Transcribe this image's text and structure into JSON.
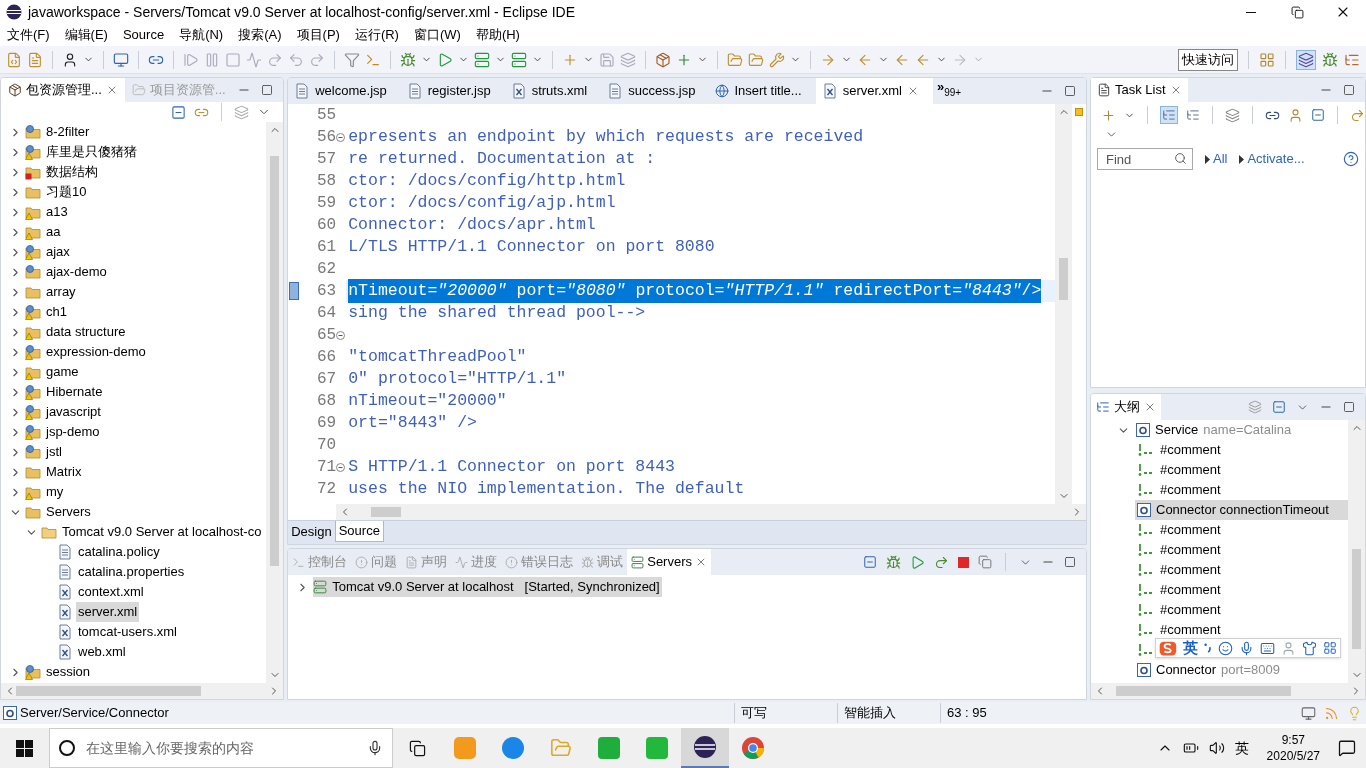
{
  "window": {
    "title": "javaworkspace - Servers/Tomcat v9.0 Server at localhost-config/server.xml - Eclipse IDE"
  },
  "menu": [
    "文件(F)",
    "编辑(E)",
    "Source",
    "导航(N)",
    "搜索(A)",
    "项目(P)",
    "运行(R)",
    "窗口(W)",
    "帮助(H)"
  ],
  "quick_access": "快速访问",
  "package_explorer": {
    "tabs": [
      {
        "label": "包资源管理...",
        "selected": true
      },
      {
        "label": "项目资源管...",
        "selected": false
      }
    ],
    "tree": [
      {
        "label": "8-2filter",
        "kind": "project",
        "warning": false,
        "error": false,
        "expanded": false,
        "selected": false
      },
      {
        "label": "库里是只傻猪猪",
        "kind": "project",
        "warning": true,
        "error": false,
        "expanded": false,
        "selected": false
      },
      {
        "label": "数据结构",
        "kind": "folder",
        "warning": false,
        "error": true,
        "expanded": false,
        "selected": false
      },
      {
        "label": "习题10",
        "kind": "folder",
        "warning": false,
        "error": false,
        "expanded": false,
        "selected": false
      },
      {
        "label": "a13",
        "kind": "folder",
        "warning": true,
        "error": false,
        "expanded": false,
        "selected": false
      },
      {
        "label": "aa",
        "kind": "folder",
        "warning": true,
        "error": false,
        "expanded": false,
        "selected": false
      },
      {
        "label": "ajax",
        "kind": "project",
        "warning": true,
        "error": false,
        "expanded": false,
        "selected": false
      },
      {
        "label": "ajax-demo",
        "kind": "project",
        "warning": false,
        "error": false,
        "expanded": false,
        "selected": false
      },
      {
        "label": "array",
        "kind": "folder",
        "warning": false,
        "error": false,
        "expanded": false,
        "selected": false
      },
      {
        "label": "ch1",
        "kind": "project",
        "warning": true,
        "error": false,
        "expanded": false,
        "selected": false
      },
      {
        "label": "data structure",
        "kind": "folder",
        "warning": true,
        "error": false,
        "expanded": false,
        "selected": false
      },
      {
        "label": "expression-demo",
        "kind": "project",
        "warning": true,
        "error": false,
        "expanded": false,
        "selected": false
      },
      {
        "label": "game",
        "kind": "folder",
        "warning": true,
        "error": false,
        "expanded": false,
        "selected": false
      },
      {
        "label": "Hibernate",
        "kind": "project",
        "warning": true,
        "error": false,
        "expanded": false,
        "selected": false
      },
      {
        "label": "javascript",
        "kind": "project",
        "warning": true,
        "error": false,
        "expanded": false,
        "selected": false
      },
      {
        "label": "jsp-demo",
        "kind": "project",
        "warning": true,
        "error": false,
        "expanded": false,
        "selected": false
      },
      {
        "label": "jstl",
        "kind": "project",
        "warning": false,
        "error": false,
        "expanded": false,
        "selected": false
      },
      {
        "label": "Matrix",
        "kind": "folder",
        "warning": false,
        "error": false,
        "expanded": false,
        "selected": false
      },
      {
        "label": "my",
        "kind": "folder",
        "warning": true,
        "error": false,
        "expanded": false,
        "selected": false
      },
      {
        "label": "Servers",
        "kind": "folder",
        "warning": false,
        "error": false,
        "expanded": true,
        "selected": false,
        "children": [
          {
            "label": "Tomcat v9.0 Server at localhost-co",
            "kind": "open-folder",
            "expanded": true,
            "selected": false,
            "children": [
              {
                "label": "catalina.policy",
                "kind": "file",
                "selected": false
              },
              {
                "label": "catalina.properties",
                "kind": "file",
                "selected": false
              },
              {
                "label": "context.xml",
                "kind": "xml",
                "selected": false
              },
              {
                "label": "server.xml",
                "kind": "xml",
                "selected": true
              },
              {
                "label": "tomcat-users.xml",
                "kind": "xml",
                "selected": false
              },
              {
                "label": "web.xml",
                "kind": "xml",
                "selected": false
              }
            ]
          }
        ]
      },
      {
        "label": "session",
        "kind": "project",
        "warning": true,
        "error": false,
        "expanded": false,
        "selected": false
      }
    ]
  },
  "editor": {
    "tabs": [
      {
        "label": "welcome.jsp",
        "kind": "page",
        "selected": false
      },
      {
        "label": "register.jsp",
        "kind": "page",
        "selected": false
      },
      {
        "label": "struts.xml",
        "kind": "xml",
        "selected": false
      },
      {
        "label": "success.jsp",
        "kind": "page",
        "selected": false
      },
      {
        "label": "Insert title...",
        "kind": "web",
        "selected": false
      },
      {
        "label": "server.xml",
        "kind": "xml",
        "selected": true
      }
    ],
    "overflow": {
      "mark": "»",
      "count": "99+"
    },
    "lines": [
      {
        "number": "55",
        "fold": false,
        "selected": false
      },
      {
        "number": "56",
        "text": "epresents an endpoint by which requests are received",
        "fold": true,
        "selected": false
      },
      {
        "number": "57",
        "text": "re returned. Documentation at :",
        "fold": false,
        "selected": false
      },
      {
        "number": "58",
        "text": "ctor: /docs/config/http.html",
        "fold": false,
        "selected": false
      },
      {
        "number": "59",
        "text": "ctor: /docs/config/ajp.html",
        "fold": false,
        "selected": false
      },
      {
        "number": "60",
        "text": "Connector: /docs/apr.html",
        "fold": false,
        "selected": false
      },
      {
        "number": "61",
        "text": "L/TLS HTTP/1.1 Connector on port 8080",
        "fold": false,
        "selected": false
      },
      {
        "number": "62",
        "fold": false,
        "selected": false
      },
      {
        "number": "63",
        "text": "nTimeout=*\"20000\"* port=*\"8080\"* protocol=*\"HTTP/1.1\"* redirectPort=*\"8443\"*/>",
        "fold": false,
        "selected": true
      },
      {
        "number": "64",
        "text": "sing the shared thread pool-->",
        "fold": false,
        "selected": false
      },
      {
        "number": "65",
        "fold": true,
        "selected": false
      },
      {
        "number": "66",
        "text": "\"tomcatThreadPool\"",
        "fold": false,
        "selected": false
      },
      {
        "number": "67",
        "text": "0\" protocol=\"HTTP/1.1\"",
        "fold": false,
        "selected": false
      },
      {
        "number": "68",
        "text": "nTimeout=\"20000\"",
        "fold": false,
        "selected": false
      },
      {
        "number": "69",
        "text": "ort=\"8443\" />",
        "fold": false,
        "selected": false
      },
      {
        "number": "70",
        "fold": false,
        "selected": false
      },
      {
        "number": "71",
        "text": "S HTTP/1.1 Connector on port 8443",
        "fold": true,
        "selected": false
      },
      {
        "number": "72",
        "text": "uses the NIO implementation. The default",
        "fold": false,
        "selected": false
      }
    ],
    "bottom_tabs": [
      {
        "label": "Design",
        "selected": false
      },
      {
        "label": "Source",
        "selected": true
      }
    ]
  },
  "servers_view": {
    "tabs": [
      {
        "label": "控制台",
        "selected": false
      },
      {
        "label": "问题",
        "selected": false
      },
      {
        "label": "声明",
        "selected": false
      },
      {
        "label": "进度",
        "selected": false
      },
      {
        "label": "错误日志",
        "selected": false
      },
      {
        "label": "调试",
        "selected": false
      },
      {
        "label": "Servers",
        "selected": true
      }
    ],
    "servers": [
      {
        "name": "Tomcat v9.0 Server at localhost",
        "status": "[Started, Synchronized]",
        "expanded": false,
        "selected": true
      }
    ]
  },
  "task_list": {
    "title": "Task List",
    "find": {
      "placeholder": "Find"
    },
    "links": [
      "All",
      "Activate..."
    ]
  },
  "outline": {
    "title": "大纲",
    "tree": [
      {
        "kind": "element",
        "label": "Service",
        "detail": "name=Catalina",
        "expanded": true,
        "selected": false,
        "children": [
          {
            "kind": "comment",
            "label": "#comment",
            "selected": false
          },
          {
            "kind": "comment",
            "label": "#comment",
            "selected": false
          },
          {
            "kind": "comment",
            "label": "#comment",
            "selected": false
          },
          {
            "kind": "element",
            "label": "Connector connectionTimeout",
            "selected": true
          },
          {
            "kind": "comment",
            "label": "#comment",
            "selected": false
          },
          {
            "kind": "comment",
            "label": "#comment",
            "selected": false
          },
          {
            "kind": "comment",
            "label": "#comment",
            "selected": false
          },
          {
            "kind": "comment",
            "label": "#comment",
            "selected": false
          },
          {
            "kind": "comment",
            "label": "#comment",
            "selected": false
          },
          {
            "kind": "comment",
            "label": "#comment",
            "selected": false
          },
          {
            "kind": "comment",
            "selected": false
          },
          {
            "kind": "element",
            "label": "Connector",
            "detail": "port=8009",
            "selected": false
          }
        ]
      }
    ]
  },
  "ime_bar": {
    "mode": "英"
  },
  "status_bar": {
    "path": "Server/Service/Connector",
    "cells": [
      "可写",
      "智能插入",
      "63 : 95"
    ]
  },
  "taskbar": {
    "search": {
      "placeholder": "在这里输入你要搜索的内容"
    },
    "tray": {
      "language": "英",
      "time": "9:57",
      "date": "2020/5/27"
    }
  }
}
